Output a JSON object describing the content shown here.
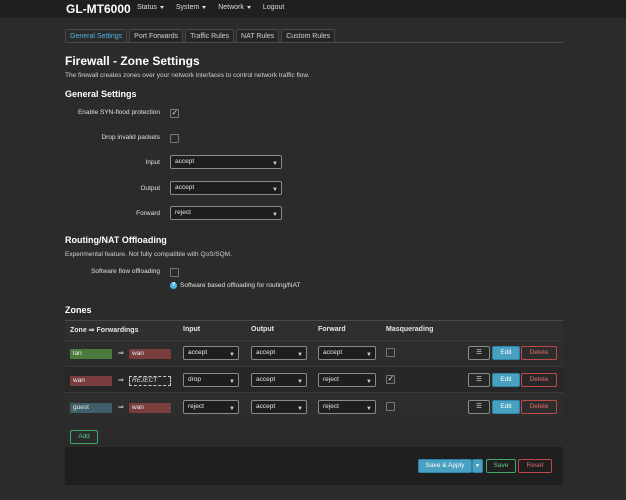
{
  "header": {
    "brand": "GL-MT6000",
    "menu": [
      "Status",
      "System",
      "Network",
      "Logout"
    ]
  },
  "tabs": [
    "General Settings",
    "Port Forwards",
    "Traffic Rules",
    "NAT Rules",
    "Custom Rules"
  ],
  "page": {
    "title": "Firewall - Zone Settings",
    "description": "The firewall creates zones over your network interfaces to control network traffic flow."
  },
  "general": {
    "heading": "General Settings",
    "syn_flood_label": "Enable SYN-flood protection",
    "syn_flood_checked": true,
    "drop_invalid_label": "Drop invalid packets",
    "drop_invalid_checked": false,
    "input_label": "Input",
    "input_value": "accept",
    "output_label": "Output",
    "output_value": "accept",
    "forward_label": "Forward",
    "forward_value": "reject"
  },
  "offloading": {
    "heading": "Routing/NAT Offloading",
    "description": "Experimental feature. Not fully compatible with QoS/SQM.",
    "software_label": "Software flow offloading",
    "software_checked": false,
    "help_text": "Software based offloading for routing/NAT"
  },
  "zones": {
    "heading": "Zones",
    "columns": [
      "Zone ⇒ Forwardings",
      "Input",
      "Output",
      "Forward",
      "Masquerading"
    ],
    "rows": [
      {
        "zone": "lan",
        "forward_to": "wan",
        "input": "accept",
        "output": "accept",
        "forward": "accept",
        "masq": false
      },
      {
        "zone": "wan",
        "forward_to": "REJECT",
        "input": "drop",
        "output": "accept",
        "forward": "reject",
        "masq": true
      },
      {
        "zone": "guest",
        "forward_to": "wan",
        "input": "reject",
        "output": "accept",
        "forward": "reject",
        "masq": false
      }
    ],
    "menu_glyph": "☰",
    "arrow_glyph": "⇒",
    "edit_label": "Edit",
    "delete_label": "Delete",
    "add_label": "Add"
  },
  "footer": {
    "save_apply_label": "Save & Apply",
    "save_label": "Save",
    "reset_label": "Reset"
  },
  "colors": {
    "lan": "#4b7a3d",
    "wan": "#7a3d3d",
    "guest": "#3e5f68",
    "accent": "#4aa0c0"
  }
}
